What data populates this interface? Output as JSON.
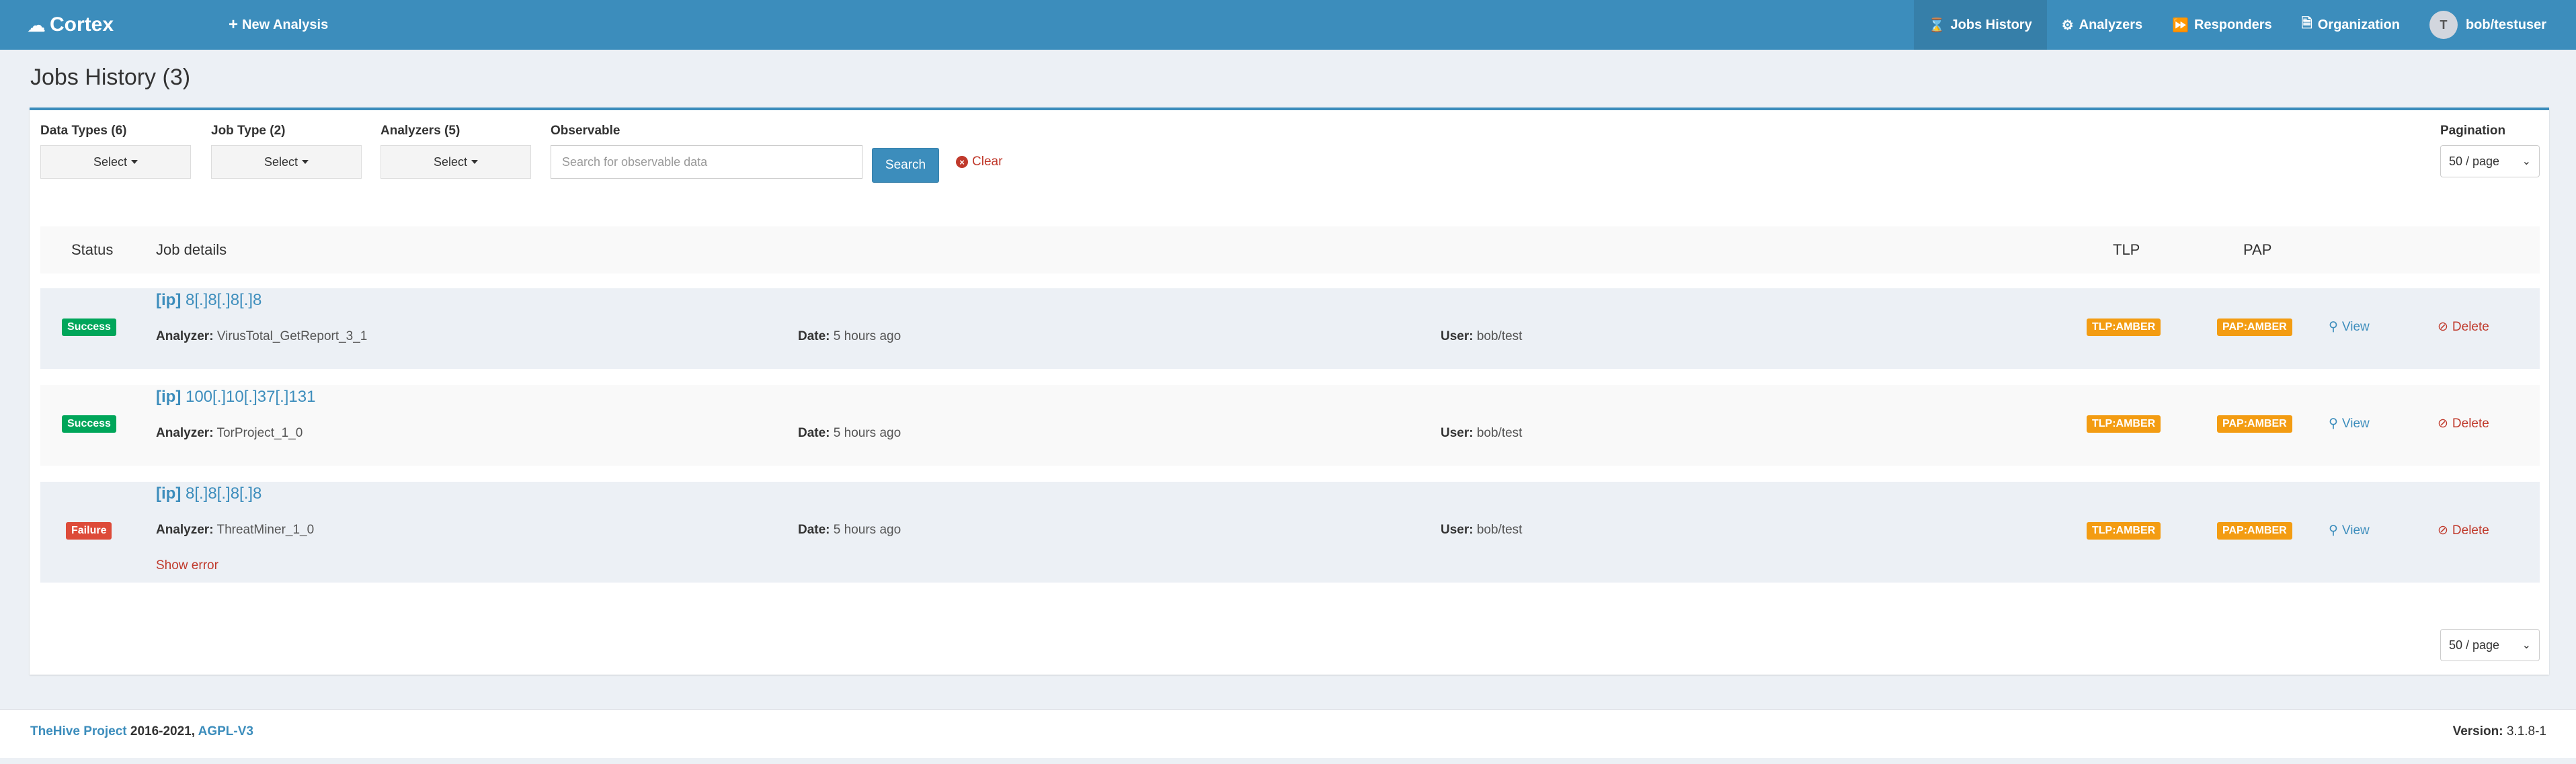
{
  "navbar": {
    "brand": "Cortex",
    "new_analysis": "New Analysis",
    "items": [
      {
        "label": "Jobs History",
        "icon": "hourglass-icon",
        "active": true
      },
      {
        "label": "Analyzers",
        "icon": "cogs-icon",
        "active": false
      },
      {
        "label": "Responders",
        "icon": "forward-icon",
        "active": false
      },
      {
        "label": "Organization",
        "icon": "document-icon",
        "active": false
      }
    ],
    "user": {
      "avatar": "T",
      "name": "bob/testuser"
    }
  },
  "page": {
    "title": "Jobs History (3)"
  },
  "filters": {
    "data_types": {
      "label": "Data Types (6)",
      "value": "Select"
    },
    "job_type": {
      "label": "Job Type (2)",
      "value": "Select"
    },
    "analyzers": {
      "label": "Analyzers (5)",
      "value": "Select"
    },
    "observable": {
      "label": "Observable",
      "placeholder": "Search for observable data"
    },
    "search_label": "Search",
    "clear_label": "Clear",
    "pagination": {
      "label": "Pagination",
      "value": "50 / page"
    }
  },
  "table": {
    "headers": {
      "status": "Status",
      "details": "Job details",
      "tlp": "TLP",
      "pap": "PAP"
    },
    "rows": [
      {
        "status": "Success",
        "status_kind": "success",
        "datatype": "[ip]",
        "observable": "8[.]8[.]8[.]8",
        "analyzer_label": "Analyzer:",
        "analyzer": "VirusTotal_GetReport_3_1",
        "date_label": "Date:",
        "date": "5 hours ago",
        "user_label": "User:",
        "user": "bob/test",
        "tlp": "TLP:AMBER",
        "pap": "PAP:AMBER",
        "view": "View",
        "delete": "Delete"
      },
      {
        "status": "Success",
        "status_kind": "success",
        "datatype": "[ip]",
        "observable": "100[.]10[.]37[.]131",
        "analyzer_label": "Analyzer:",
        "analyzer": "TorProject_1_0",
        "date_label": "Date:",
        "date": "5 hours ago",
        "user_label": "User:",
        "user": "bob/test",
        "tlp": "TLP:AMBER",
        "pap": "PAP:AMBER",
        "view": "View",
        "delete": "Delete"
      },
      {
        "status": "Failure",
        "status_kind": "failure",
        "datatype": "[ip]",
        "observable": "8[.]8[.]8[.]8",
        "analyzer_label": "Analyzer:",
        "analyzer": "ThreatMiner_1_0",
        "date_label": "Date:",
        "date": "5 hours ago",
        "user_label": "User:",
        "user": "bob/test",
        "tlp": "TLP:AMBER",
        "pap": "PAP:AMBER",
        "view": "View",
        "delete": "Delete",
        "error_link": "Show error"
      }
    ]
  },
  "bottom_pagination": "50 / page",
  "footer": {
    "project": "TheHive Project",
    "years": " 2016-2021, ",
    "license": "AGPL-V3",
    "version_label": "Version: ",
    "version": "3.1.8-1"
  },
  "colors": {
    "primary": "#3c8dbc",
    "success": "#00a65a",
    "failure": "#dd4b39",
    "amber": "#f39c12",
    "danger": "#c0392b"
  }
}
